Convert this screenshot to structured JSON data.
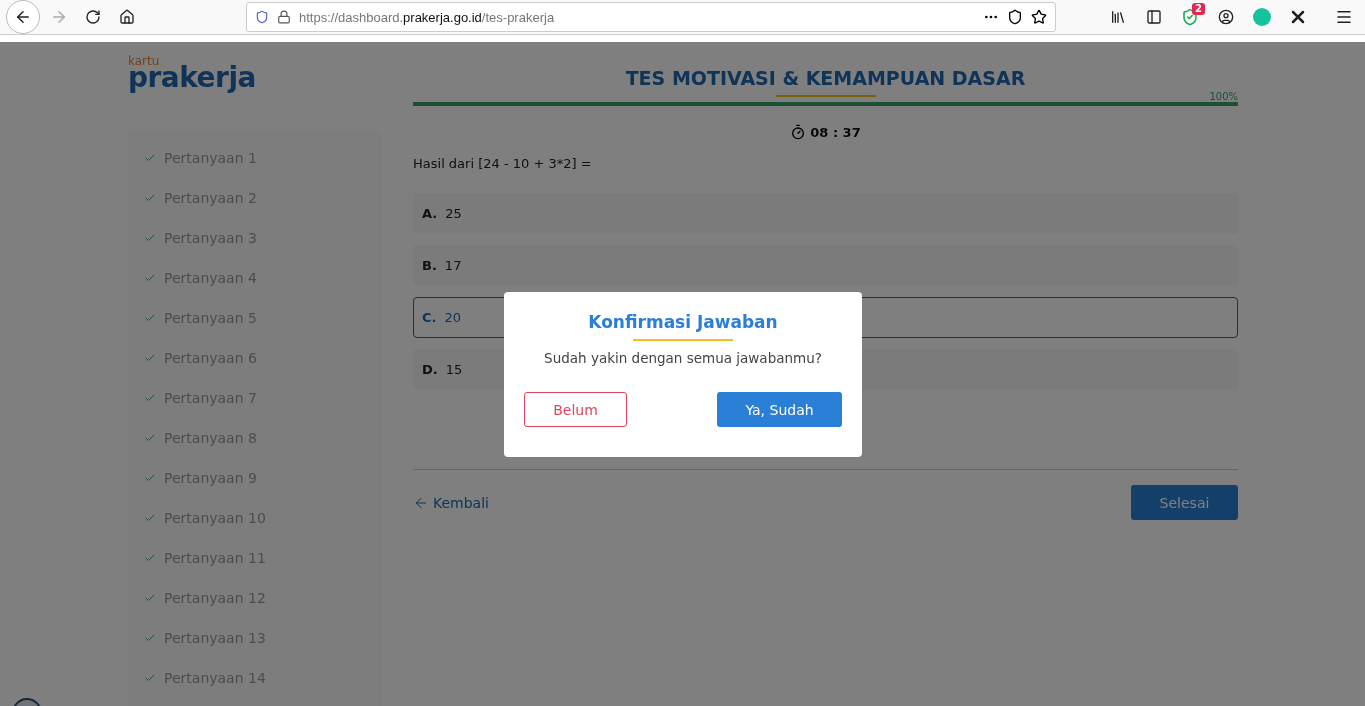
{
  "browser": {
    "url": {
      "prefix": "https://dashboard.",
      "domain": "prakerja.go.id",
      "path": "/tes-prakerja"
    },
    "badge": "2"
  },
  "logo": {
    "small": "kartu",
    "main": "prakerja"
  },
  "header": {
    "title": "TES MOTIVASI & KEMAMPUAN DASAR",
    "progress": {
      "level": 1,
      "label": "100%"
    },
    "timer": "08 : 37"
  },
  "sidebar": {
    "items": [
      {
        "label": "Pertanyaan 1",
        "checked": true
      },
      {
        "label": "Pertanyaan 2",
        "checked": true
      },
      {
        "label": "Pertanyaan 3",
        "checked": true
      },
      {
        "label": "Pertanyaan 4",
        "checked": true
      },
      {
        "label": "Pertanyaan 5",
        "checked": true
      },
      {
        "label": "Pertanyaan 6",
        "checked": true
      },
      {
        "label": "Pertanyaan 7",
        "checked": true
      },
      {
        "label": "Pertanyaan 8",
        "checked": true
      },
      {
        "label": "Pertanyaan 9",
        "checked": true
      },
      {
        "label": "Pertanyaan 10",
        "checked": true
      },
      {
        "label": "Pertanyaan 11",
        "checked": true
      },
      {
        "label": "Pertanyaan 12",
        "checked": true
      },
      {
        "label": "Pertanyaan 13",
        "checked": true
      },
      {
        "label": "Pertanyaan 14",
        "checked": true
      }
    ]
  },
  "question": {
    "text": "Hasil dari [24 - 10 + 3*2] =",
    "options": [
      {
        "letter": "A.",
        "text": "25",
        "selected": false
      },
      {
        "letter": "B.",
        "text": "17",
        "selected": false
      },
      {
        "letter": "C.",
        "text": "20",
        "selected": true
      },
      {
        "letter": "D.",
        "text": "15",
        "selected": false
      }
    ]
  },
  "footer": {
    "back": "Kembali",
    "finish": "Selesai"
  },
  "modal": {
    "title": "Konfirmasi Jawaban",
    "message": "Sudah yakin dengan semua jawabanmu?",
    "cancel": "Belum",
    "confirm": "Ya, Sudah"
  }
}
